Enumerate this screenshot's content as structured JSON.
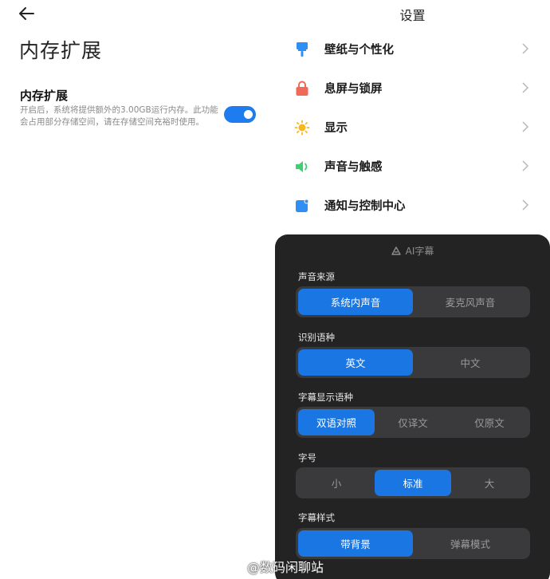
{
  "left": {
    "title": "内存扩展",
    "setting": {
      "title": "内存扩展",
      "description": "开启后，系统将提供额外的3.00GB运行内存。此功能会占用部分存储空间，请在存储空间充裕时使用。",
      "enabled": true
    }
  },
  "right": {
    "title": "设置",
    "menu": [
      {
        "label": "壁纸与个性化",
        "icon": "wallpaper-icon",
        "color": "#2f8ff4"
      },
      {
        "label": "息屏与锁屏",
        "icon": "lock-icon",
        "color": "#f06a5a"
      },
      {
        "label": "显示",
        "icon": "sun-icon",
        "color": "#f5b81e"
      },
      {
        "label": "声音与触感",
        "icon": "speaker-icon",
        "color": "#3fcf73"
      },
      {
        "label": "通知与控制中心",
        "icon": "notification-icon",
        "color": "#2f8ff4"
      }
    ]
  },
  "panel": {
    "title": "AI字幕",
    "groups": [
      {
        "label": "声音来源",
        "options": [
          "系统内声音",
          "麦克风声音"
        ],
        "selected": 0
      },
      {
        "label": "识别语种",
        "options": [
          "英文",
          "中文"
        ],
        "selected": 0
      },
      {
        "label": "字幕显示语种",
        "options": [
          "双语对照",
          "仅译文",
          "仅原文"
        ],
        "selected": 0
      },
      {
        "label": "字号",
        "options": [
          "小",
          "标准",
          "大"
        ],
        "selected": 1
      },
      {
        "label": "字幕样式",
        "options": [
          "带背景",
          "弹幕模式"
        ],
        "selected": 0
      }
    ]
  },
  "watermark": "@数码闲聊站",
  "colors": {
    "accent": "#1a76e3",
    "toggle": "#1e7cf0",
    "panel_bg": "#232324"
  }
}
